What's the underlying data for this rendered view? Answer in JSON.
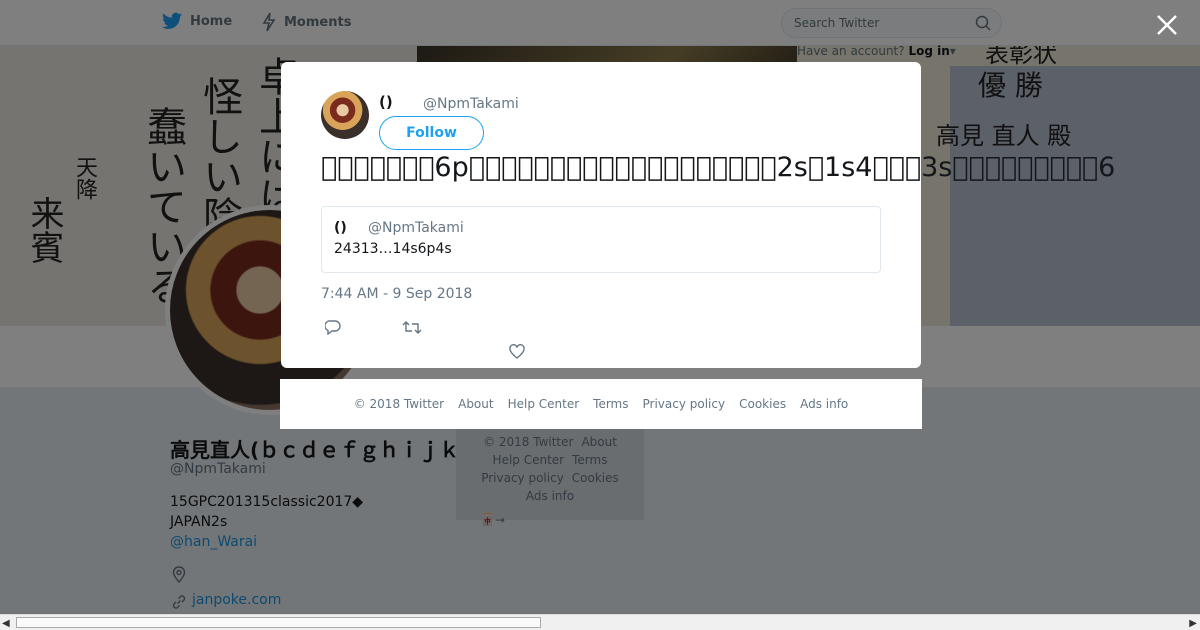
{
  "nav": {
    "home_label": "Home",
    "moments_label": "Moments",
    "search_placeholder": "Search Twitter",
    "have_account": "Have an account?",
    "login_label": "Log in"
  },
  "banner": {
    "calligraphy": [
      "卓上には",
      "怪しい陰",
      "蠢いている",
      "来賓",
      "天降"
    ],
    "cert_lines": [
      "表彰状",
      "優 勝",
      "高見 直人 殿"
    ]
  },
  "profile": {
    "name": "高見直人(ｂｃｄｅｆｇｈｉｊｋｌｍ)",
    "handle": "@NpmTakami",
    "bio_line1": "15GPC201315classic2017◆",
    "bio_line2": "JAPAN2s",
    "bio_link": "@han_Warai",
    "url": "janpoke.com",
    "small_text": "🀄→"
  },
  "bg_footer": {
    "copyright": "© 2018 Twitter",
    "about": "About",
    "help": "Help Center",
    "terms": "Terms",
    "privacy": "Privacy policy",
    "cookies": "Cookies",
    "ads": "Ads info"
  },
  "tweet": {
    "name": "()",
    "handle": "@NpmTakami",
    "follow_label": "Follow",
    "text": "􀀀􀀀􀀀􀀀􀀀􀀀􀀀6p􀀀􀀀􀀀􀀀􀀀􀀀􀀀􀀀􀀀􀀀􀀀􀀀􀀀􀀀􀀀􀀀􀀀􀀀􀀀2s􀀀1s4􀀀􀀀􀀀3s􀀀􀀀􀀀􀀀􀀀􀀀􀀀􀀀􀀀6",
    "quote_name": "()",
    "quote_handle": "@NpmTakami",
    "quote_text": "24313…14s6p4s",
    "time": "7:44 AM - 9 Sep 2018"
  },
  "footer": {
    "copyright": "© 2018 Twitter",
    "about": "About",
    "help": "Help Center",
    "terms": "Terms",
    "privacy": "Privacy policy",
    "cookies": "Cookies",
    "ads": "Ads info"
  },
  "scrollbar": {
    "left_arrow": "◀",
    "right_arrow": "▶"
  },
  "colors": {
    "accent": "#1da1f2",
    "link": "#1b95e0",
    "muted": "#657786"
  }
}
